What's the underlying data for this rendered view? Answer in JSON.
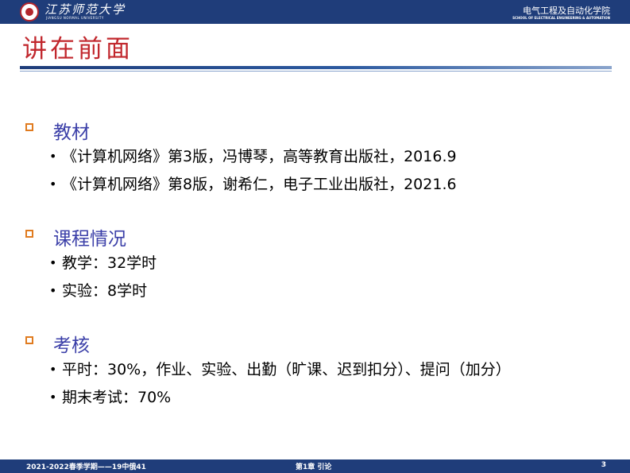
{
  "header": {
    "university_name": "江苏师范大学",
    "university_name_en": "JIANGSU NORMAL UNIVERSITY",
    "school_name": "电气工程及自动化学院",
    "school_name_en": "SCHOOL OF ELECTRICAL ENGINEERING & AUTOMATION",
    "colors": {
      "bar": "#1f3d7a",
      "title": "#c1272d",
      "section_title": "#3b3fa8",
      "bullet_box": "#e07b1f"
    }
  },
  "slide": {
    "title": "讲在前面",
    "sections": [
      {
        "title": "教材",
        "items": [
          "《计算机网络》第3版，冯博琴，高等教育出版社，2016.9",
          "《计算机网络》第8版，谢希仁，电子工业出版社，2021.6"
        ]
      },
      {
        "title": "课程情况",
        "items": [
          "教学：32学时",
          "实验：8学时"
        ]
      },
      {
        "title": "考核",
        "items": [
          "平时：30%，作业、实验、出勤（旷课、迟到扣分）、提问（加分）",
          "期末考试：70%"
        ]
      }
    ],
    "bullet_glyph": "•"
  },
  "footer": {
    "left": "2021-2022春季学期——19中俄41",
    "center": "第1章 引论",
    "page_number": "3"
  }
}
